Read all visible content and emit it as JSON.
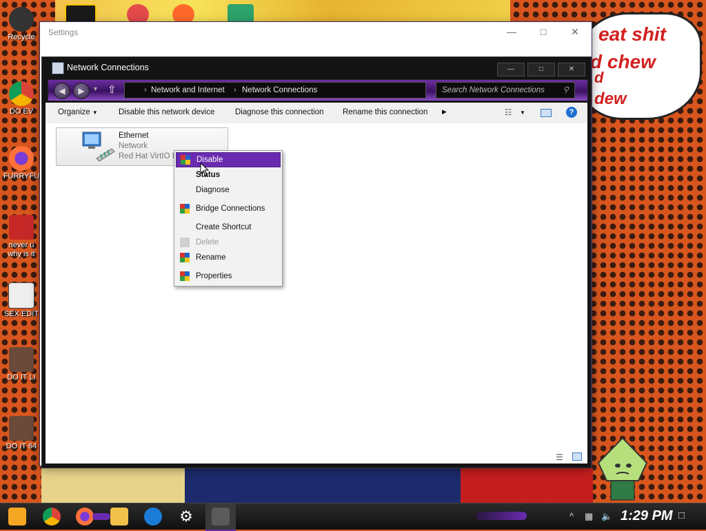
{
  "desktop": {
    "bubble_lines": [
      "eat shit",
      "d chew",
      "d",
      "dew"
    ],
    "icons": [
      {
        "label": "Recycle",
        "color": "#333333"
      },
      {
        "label": "DO EV",
        "color": "#4285f4"
      },
      {
        "label": "FURRYFU",
        "color": "#ff7139"
      },
      {
        "label": "never u why is it",
        "color": "#c62828"
      },
      {
        "label": "SEX EDIT",
        "color": "#e8e8e8"
      },
      {
        "label": "DO IT LI",
        "color": "#6b4a3a"
      },
      {
        "label": "DO IT 64",
        "color": "#6b4a3a"
      }
    ]
  },
  "settings_window": {
    "title": "Settings"
  },
  "network_window": {
    "title": "Network Connections",
    "breadcrumb": [
      "Network and Internet",
      "Network Connections"
    ],
    "search_placeholder": "Search Network Connections",
    "commands": {
      "organize": "Organize",
      "disable": "Disable this network device",
      "diagnose": "Diagnose this connection",
      "rename": "Rename this connection"
    }
  },
  "adapter": {
    "name": "Ethernet",
    "status": "Network",
    "device": "Red Hat VirtIO Et"
  },
  "context_menu": {
    "items": [
      {
        "label": "Disable",
        "state": "highlighted",
        "has_icon": true
      },
      {
        "label": "Status",
        "state": "default",
        "has_icon": false
      },
      {
        "label": "Diagnose",
        "state": "normal",
        "has_icon": false
      },
      {
        "label": "Bridge Connections",
        "state": "normal",
        "has_icon": true
      },
      {
        "label": "Create Shortcut",
        "state": "normal",
        "has_icon": false
      },
      {
        "label": "Delete",
        "state": "disabled",
        "has_icon": true
      },
      {
        "label": "Rename",
        "state": "normal",
        "has_icon": true
      },
      {
        "label": "Properties",
        "state": "normal",
        "has_icon": true
      }
    ]
  },
  "taskbar": {
    "clock": "1:29 PM",
    "accent": "#6a2bb0"
  }
}
